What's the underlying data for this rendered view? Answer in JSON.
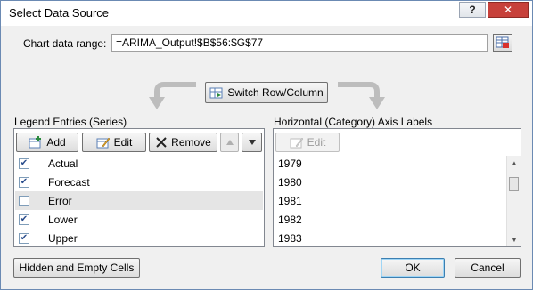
{
  "window": {
    "title": "Select Data Source",
    "help_label": "?",
    "close_label": "✕"
  },
  "chart_range": {
    "label": "Chart data range:",
    "value": "=ARIMA_Output!$B$56:$G$77"
  },
  "switch_button_label": "Switch Row/Column",
  "legend": {
    "heading": "Legend Entries (Series)",
    "add_label": "Add",
    "edit_label": "Edit",
    "remove_label": "Remove",
    "series": [
      {
        "label": "Actual",
        "checked": true
      },
      {
        "label": "Forecast",
        "checked": true
      },
      {
        "label": "Error",
        "checked": false
      },
      {
        "label": "Lower",
        "checked": true
      },
      {
        "label": "Upper",
        "checked": true
      }
    ]
  },
  "axis": {
    "heading": "Horizontal (Category) Axis Labels",
    "edit_label": "Edit",
    "labels": [
      "1979",
      "1980",
      "1981",
      "1982",
      "1983"
    ]
  },
  "buttons": {
    "hidden_cells": "Hidden and Empty Cells",
    "ok": "OK",
    "cancel": "Cancel"
  },
  "colors": {
    "close_red": "#c7413b",
    "ok_border": "#3c7fb1",
    "check_blue": "#2a4d8c"
  }
}
